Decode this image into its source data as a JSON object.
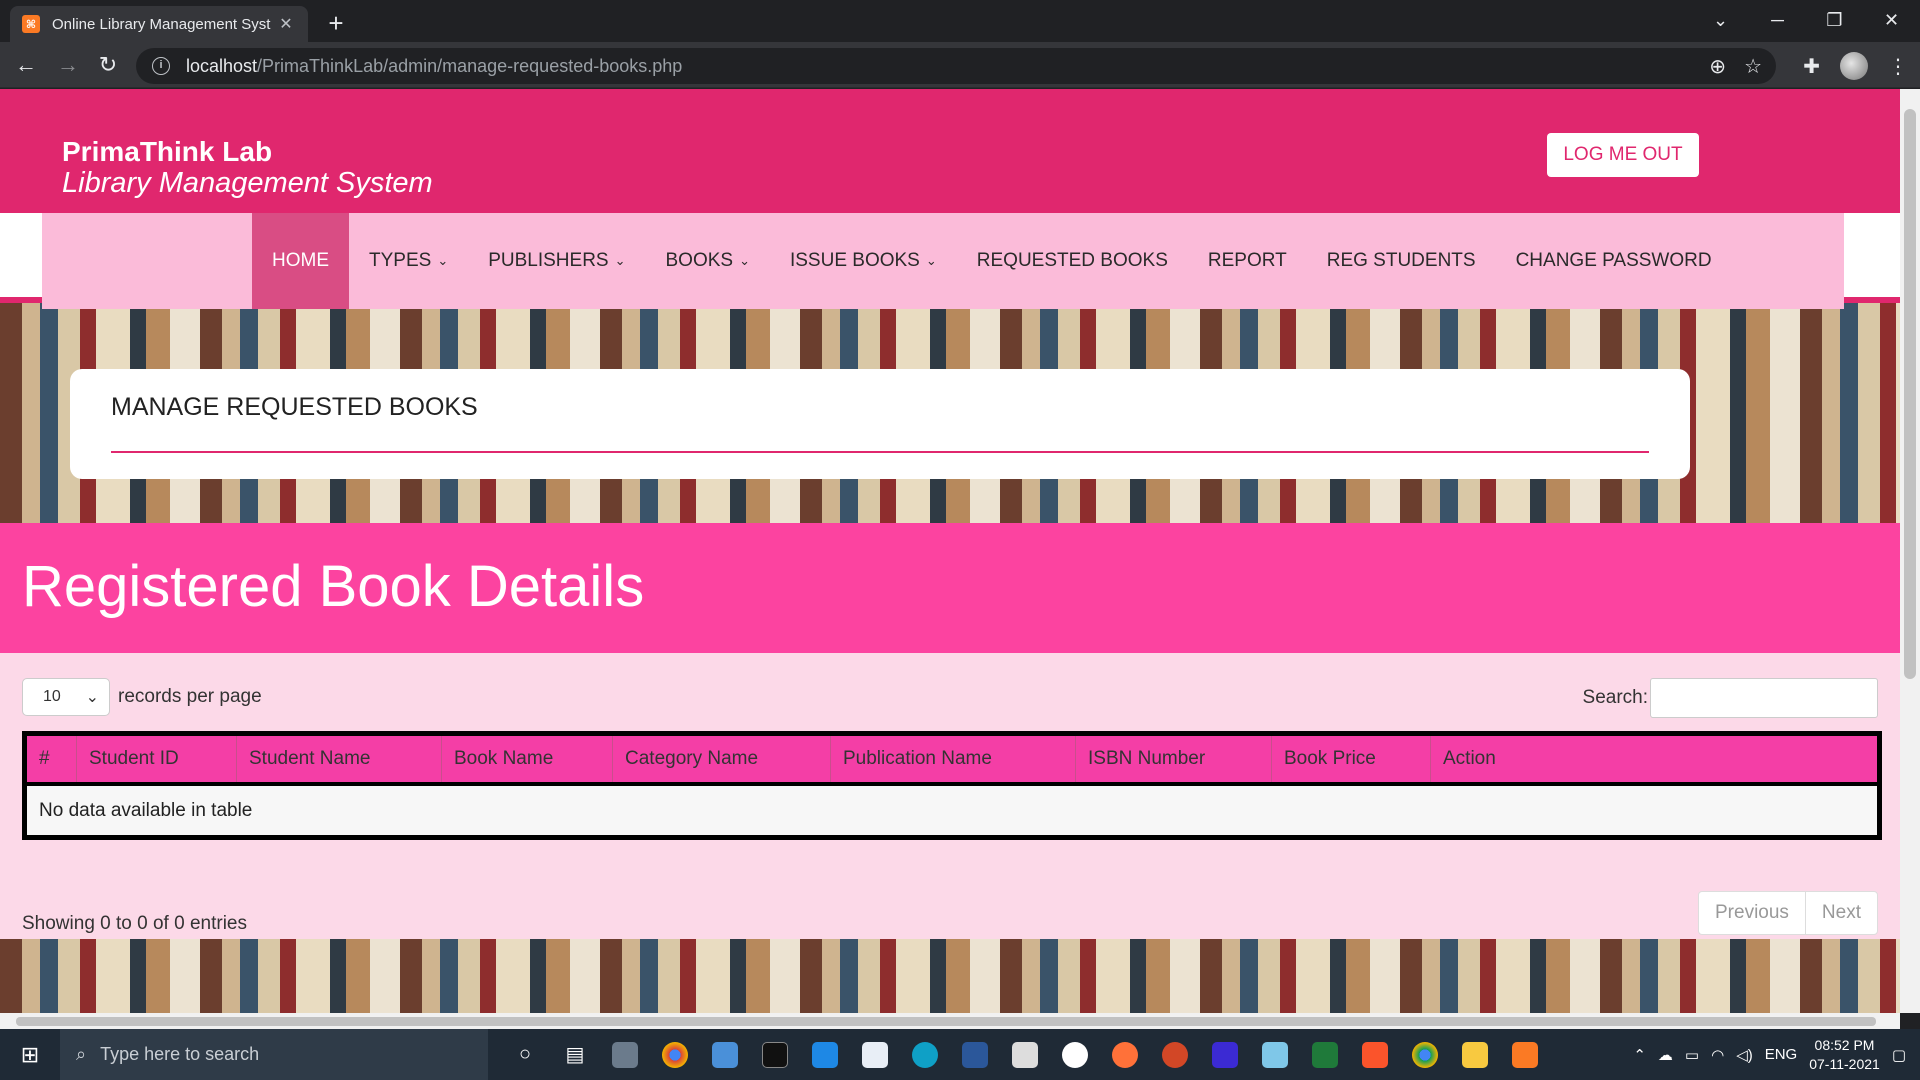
{
  "browser": {
    "tab_title": "Online Library Management Syst",
    "tab_favicon": "xampp-icon",
    "url_host": "localhost",
    "url_path": "/PrimaThinkLab/admin/manage-requested-books.php"
  },
  "header": {
    "brand_name": "PrimaThink Lab",
    "brand_subtitle": "Library Management System",
    "logout_label": "LOG ME OUT"
  },
  "nav": {
    "items": [
      {
        "label": "HOME",
        "active": true,
        "dropdown": false
      },
      {
        "label": "TYPES",
        "active": false,
        "dropdown": true
      },
      {
        "label": "PUBLISHERS",
        "active": false,
        "dropdown": true
      },
      {
        "label": "BOOKS",
        "active": false,
        "dropdown": true
      },
      {
        "label": "ISSUE BOOKS",
        "active": false,
        "dropdown": true
      },
      {
        "label": "REQUESTED BOOKS",
        "active": false,
        "dropdown": false
      },
      {
        "label": "REPORT",
        "active": false,
        "dropdown": false
      },
      {
        "label": "REG STUDENTS",
        "active": false,
        "dropdown": false
      },
      {
        "label": "CHANGE PASSWORD",
        "active": false,
        "dropdown": false
      }
    ]
  },
  "page": {
    "title": "MANAGE REQUESTED BOOKS",
    "panel_heading": "Registered Book Details"
  },
  "table_controls": {
    "page_length": "10",
    "length_label": "records per page",
    "search_label": "Search:",
    "search_value": ""
  },
  "table": {
    "columns": [
      "#",
      "Student ID",
      "Student Name",
      "Book Name",
      "Category Name",
      "Publication Name",
      "ISBN Number",
      "Book Price",
      "Action"
    ],
    "empty_message": "No data available in table"
  },
  "footer": {
    "info": "Showing 0 to 0 of 0 entries",
    "previous": "Previous",
    "next": "Next"
  },
  "taskbar": {
    "search_placeholder": "Type here to search",
    "language": "ENG",
    "time": "08:52 PM",
    "date": "07-11-2021"
  },
  "colors": {
    "header": "#e0276e",
    "nav_background": "#fbbbd9",
    "panel_heading": "#fc43a0",
    "table_header": "#f43ea6"
  }
}
